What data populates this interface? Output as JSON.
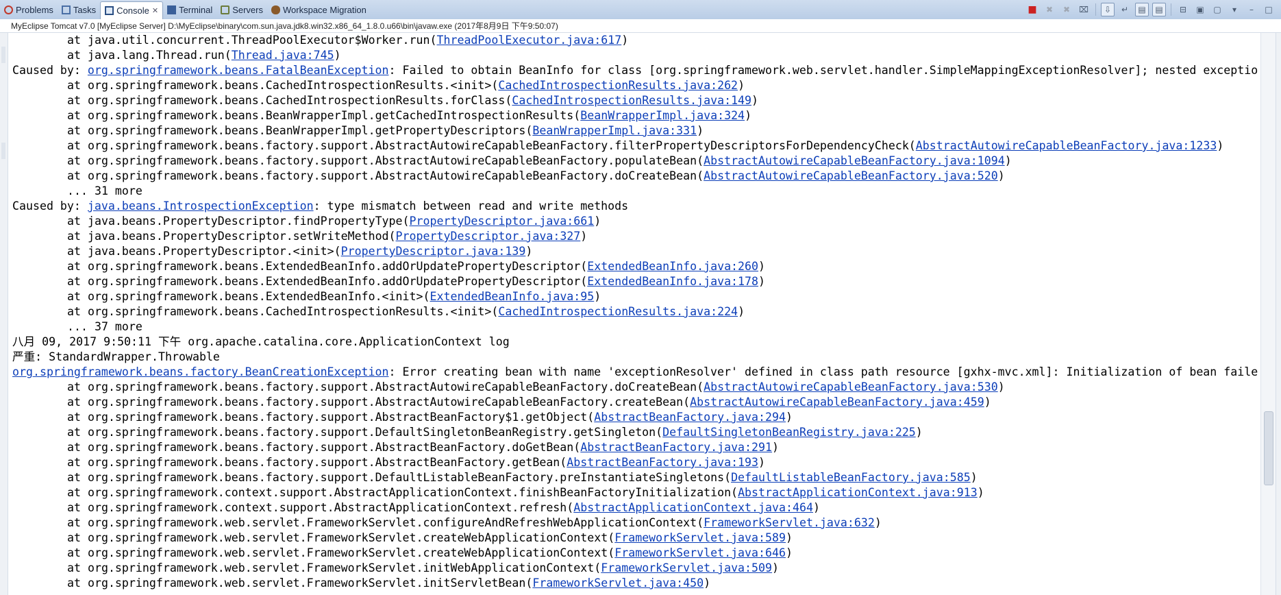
{
  "tabs": [
    {
      "label": "Problems",
      "icon": "problems-icon",
      "color": "#c0392b",
      "active": false
    },
    {
      "label": "Tasks",
      "icon": "tasks-icon",
      "color": "#4a6fa5",
      "active": false
    },
    {
      "label": "Console",
      "icon": "console-icon",
      "color": "#2b4f84",
      "active": true
    },
    {
      "label": "Terminal",
      "icon": "terminal-icon",
      "color": "#3a5f99",
      "active": false
    },
    {
      "label": "Servers",
      "icon": "servers-icon",
      "color": "#6a7b3a",
      "active": false
    },
    {
      "label": "Workspace Migration",
      "icon": "migration-icon",
      "color": "#8a5a2a",
      "active": false
    }
  ],
  "toolbar": {
    "icons": [
      "terminate-icon",
      "remove-launch-icon",
      "remove-all-icon",
      "clear-console-icon",
      "scroll-lock-icon",
      "word-wrap-icon",
      "show-on-stdout-icon",
      "show-on-stderr-icon",
      "pin-console-icon",
      "display-selected-console-icon",
      "open-console-icon",
      "view-menu-icon",
      "minimize-icon",
      "maximize-icon"
    ]
  },
  "console_title": "MyEclipse Tomcat v7.0 [MyEclipse Server] D:\\MyEclipse\\binary\\com.sun.java.jdk8.win32.x86_64_1.8.0.u66\\bin\\javaw.exe (2017年8月9日 下午9:50:07)",
  "console": {
    "lines": [
      {
        "indent": true,
        "pre": "at java.util.concurrent.ThreadPoolExecutor$Worker.run(",
        "link": "ThreadPoolExecutor.java:617",
        "post": ")"
      },
      {
        "indent": true,
        "pre": "at java.lang.Thread.run(",
        "link": "Thread.java:745",
        "post": ")"
      },
      {
        "indent": false,
        "pre": "Caused by: ",
        "link": "org.springframework.beans.FatalBeanException",
        "post": ": Failed to obtain BeanInfo for class [org.springframework.web.servlet.handler.SimpleMappingExceptionResolver]; nested exceptio"
      },
      {
        "indent": true,
        "pre": "at org.springframework.beans.CachedIntrospectionResults.<init>(",
        "link": "CachedIntrospectionResults.java:262",
        "post": ")"
      },
      {
        "indent": true,
        "pre": "at org.springframework.beans.CachedIntrospectionResults.forClass(",
        "link": "CachedIntrospectionResults.java:149",
        "post": ")"
      },
      {
        "indent": true,
        "pre": "at org.springframework.beans.BeanWrapperImpl.getCachedIntrospectionResults(",
        "link": "BeanWrapperImpl.java:324",
        "post": ")"
      },
      {
        "indent": true,
        "pre": "at org.springframework.beans.BeanWrapperImpl.getPropertyDescriptors(",
        "link": "BeanWrapperImpl.java:331",
        "post": ")"
      },
      {
        "indent": true,
        "pre": "at org.springframework.beans.factory.support.AbstractAutowireCapableBeanFactory.filterPropertyDescriptorsForDependencyCheck(",
        "link": "AbstractAutowireCapableBeanFactory.java:1233",
        "post": ")"
      },
      {
        "indent": true,
        "pre": "at org.springframework.beans.factory.support.AbstractAutowireCapableBeanFactory.populateBean(",
        "link": "AbstractAutowireCapableBeanFactory.java:1094",
        "post": ")"
      },
      {
        "indent": true,
        "pre": "at org.springframework.beans.factory.support.AbstractAutowireCapableBeanFactory.doCreateBean(",
        "link": "AbstractAutowireCapableBeanFactory.java:520",
        "post": ")"
      },
      {
        "indent": true,
        "pre": "... 31 more",
        "link": "",
        "post": ""
      },
      {
        "indent": false,
        "pre": "Caused by: ",
        "link": "java.beans.IntrospectionException",
        "post": ": type mismatch between read and write methods"
      },
      {
        "indent": true,
        "pre": "at java.beans.PropertyDescriptor.findPropertyType(",
        "link": "PropertyDescriptor.java:661",
        "post": ")"
      },
      {
        "indent": true,
        "pre": "at java.beans.PropertyDescriptor.setWriteMethod(",
        "link": "PropertyDescriptor.java:327",
        "post": ")"
      },
      {
        "indent": true,
        "pre": "at java.beans.PropertyDescriptor.<init>(",
        "link": "PropertyDescriptor.java:139",
        "post": ")"
      },
      {
        "indent": true,
        "pre": "at org.springframework.beans.ExtendedBeanInfo.addOrUpdatePropertyDescriptor(",
        "link": "ExtendedBeanInfo.java:260",
        "post": ")"
      },
      {
        "indent": true,
        "pre": "at org.springframework.beans.ExtendedBeanInfo.addOrUpdatePropertyDescriptor(",
        "link": "ExtendedBeanInfo.java:178",
        "post": ")"
      },
      {
        "indent": true,
        "pre": "at org.springframework.beans.ExtendedBeanInfo.<init>(",
        "link": "ExtendedBeanInfo.java:95",
        "post": ")"
      },
      {
        "indent": true,
        "pre": "at org.springframework.beans.CachedIntrospectionResults.<init>(",
        "link": "CachedIntrospectionResults.java:224",
        "post": ")"
      },
      {
        "indent": true,
        "pre": "... 37 more",
        "link": "",
        "post": ""
      },
      {
        "indent": false,
        "pre": "八月 09, 2017 9:50:11 下午 org.apache.catalina.core.ApplicationContext log",
        "link": "",
        "post": ""
      },
      {
        "indent": false,
        "pre": "严重: StandardWrapper.Throwable",
        "link": "",
        "post": ""
      },
      {
        "indent": false,
        "pre": "",
        "link": "org.springframework.beans.factory.BeanCreationException",
        "post": ": Error creating bean with name 'exceptionResolver' defined in class path resource [gxhx-mvc.xml]: Initialization of bean faile"
      },
      {
        "indent": true,
        "pre": "at org.springframework.beans.factory.support.AbstractAutowireCapableBeanFactory.doCreateBean(",
        "link": "AbstractAutowireCapableBeanFactory.java:530",
        "post": ")"
      },
      {
        "indent": true,
        "pre": "at org.springframework.beans.factory.support.AbstractAutowireCapableBeanFactory.createBean(",
        "link": "AbstractAutowireCapableBeanFactory.java:459",
        "post": ")"
      },
      {
        "indent": true,
        "pre": "at org.springframework.beans.factory.support.AbstractBeanFactory$1.getObject(",
        "link": "AbstractBeanFactory.java:294",
        "post": ")"
      },
      {
        "indent": true,
        "pre": "at org.springframework.beans.factory.support.DefaultSingletonBeanRegistry.getSingleton(",
        "link": "DefaultSingletonBeanRegistry.java:225",
        "post": ")"
      },
      {
        "indent": true,
        "pre": "at org.springframework.beans.factory.support.AbstractBeanFactory.doGetBean(",
        "link": "AbstractBeanFactory.java:291",
        "post": ")"
      },
      {
        "indent": true,
        "pre": "at org.springframework.beans.factory.support.AbstractBeanFactory.getBean(",
        "link": "AbstractBeanFactory.java:193",
        "post": ")"
      },
      {
        "indent": true,
        "pre": "at org.springframework.beans.factory.support.DefaultListableBeanFactory.preInstantiateSingletons(",
        "link": "DefaultListableBeanFactory.java:585",
        "post": ")"
      },
      {
        "indent": true,
        "pre": "at org.springframework.context.support.AbstractApplicationContext.finishBeanFactoryInitialization(",
        "link": "AbstractApplicationContext.java:913",
        "post": ")"
      },
      {
        "indent": true,
        "pre": "at org.springframework.context.support.AbstractApplicationContext.refresh(",
        "link": "AbstractApplicationContext.java:464",
        "post": ")"
      },
      {
        "indent": true,
        "pre": "at org.springframework.web.servlet.FrameworkServlet.configureAndRefreshWebApplicationContext(",
        "link": "FrameworkServlet.java:632",
        "post": ")"
      },
      {
        "indent": true,
        "pre": "at org.springframework.web.servlet.FrameworkServlet.createWebApplicationContext(",
        "link": "FrameworkServlet.java:589",
        "post": ")"
      },
      {
        "indent": true,
        "pre": "at org.springframework.web.servlet.FrameworkServlet.createWebApplicationContext(",
        "link": "FrameworkServlet.java:646",
        "post": ")"
      },
      {
        "indent": true,
        "pre": "at org.springframework.web.servlet.FrameworkServlet.initWebApplicationContext(",
        "link": "FrameworkServlet.java:509",
        "post": ")"
      },
      {
        "indent": true,
        "pre": "at org.springframework.web.servlet.FrameworkServlet.initServletBean(",
        "link": "FrameworkServlet.java:450",
        "post": ")"
      }
    ]
  }
}
